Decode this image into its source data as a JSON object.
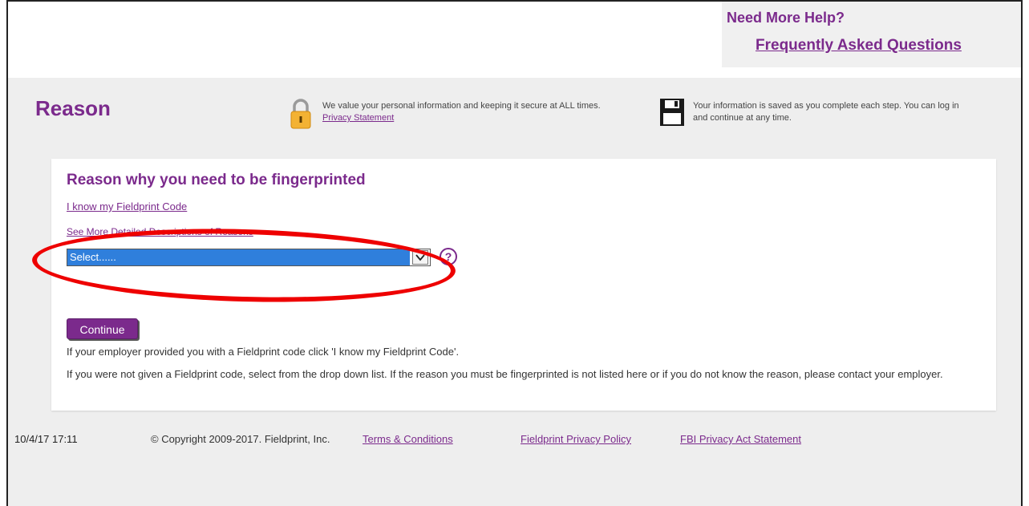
{
  "header": {
    "help_title": "Need More Help?",
    "faq_link": "Frequently Asked Questions"
  },
  "page": {
    "title": "Reason",
    "security_text": "We value your personal information and keeping it secure at ALL times.",
    "privacy_link": "Privacy Statement",
    "save_text_line1": "Your information is saved as you complete each step. You can log in",
    "save_text_line2": "and continue at any time."
  },
  "form": {
    "heading": "Reason why you need to be fingerprinted",
    "know_code_link": "I know my Fieldprint Code",
    "detailed_link": "See More Detailed Descriptions of Reasons",
    "reason_select_value": "Select......",
    "help_icon_glyph": "?",
    "continue_label": "Continue",
    "note1": "If your employer provided you with a Fieldprint code click 'I know my Fieldprint Code'.",
    "note2": "If you were not given a Fieldprint code, select from the drop down list. If the reason you must be fingerprinted is not listed here or if you do not know the reason, please contact your employer."
  },
  "footer": {
    "timestamp": "10/4/17 17:11",
    "copyright": "© Copyright 2009-2017. Fieldprint, Inc.",
    "terms_link": "Terms & Conditions",
    "privacy_policy_link": "Fieldprint Privacy Policy",
    "fbi_link": "FBI Privacy Act Statement"
  },
  "colors": {
    "brand_purple": "#7b2a8c",
    "select_highlight": "#2f7fdc",
    "annotation_red": "#ee0000"
  }
}
